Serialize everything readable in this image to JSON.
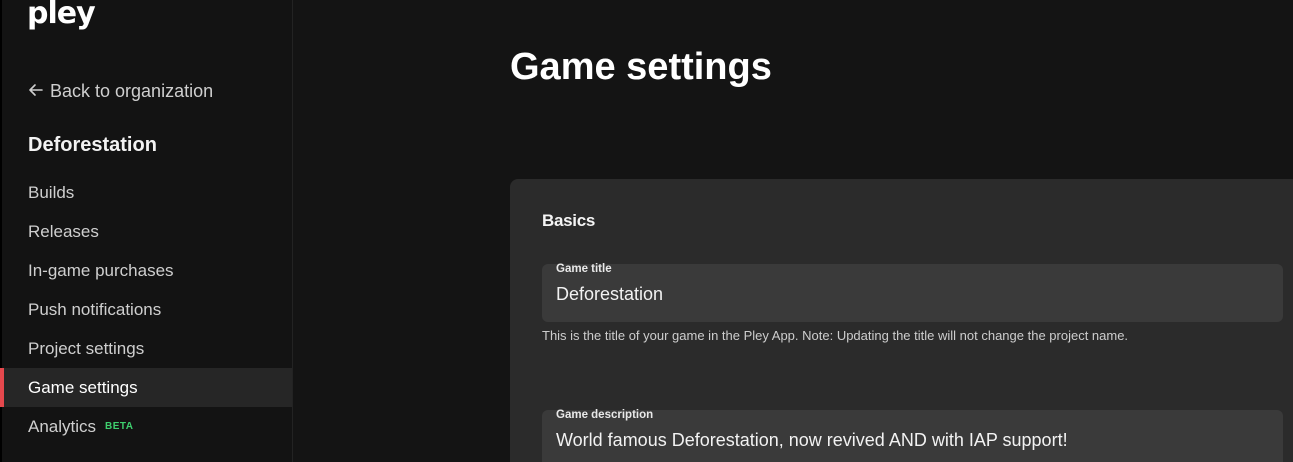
{
  "brand": {
    "logo": "pley"
  },
  "sidebar": {
    "back_link": "Back to organization",
    "project_name": "Deforestation",
    "items": [
      {
        "label": "Builds"
      },
      {
        "label": "Releases"
      },
      {
        "label": "In-game purchases"
      },
      {
        "label": "Push notifications"
      },
      {
        "label": "Project settings"
      },
      {
        "label": "Game settings",
        "active": true
      },
      {
        "label": "Analytics",
        "badge": "BETA"
      }
    ]
  },
  "main": {
    "title": "Game settings",
    "card": {
      "title": "Basics",
      "game_title": {
        "label": "Game title",
        "value": "Deforestation",
        "help": "This is the title of your game in the Pley App. Note: Updating the title will not change the project name."
      },
      "game_description": {
        "label": "Game description",
        "value": "World famous Deforestation, now revived AND with IAP support!"
      }
    }
  },
  "colors": {
    "background": "#141414",
    "sidebar": "#131313",
    "card": "#2b2b2b",
    "field": "#3a3a3a",
    "active_indicator": "#e5484d",
    "badge": "#3ecf6e"
  },
  "icons": {
    "back": "arrow-left-icon"
  }
}
